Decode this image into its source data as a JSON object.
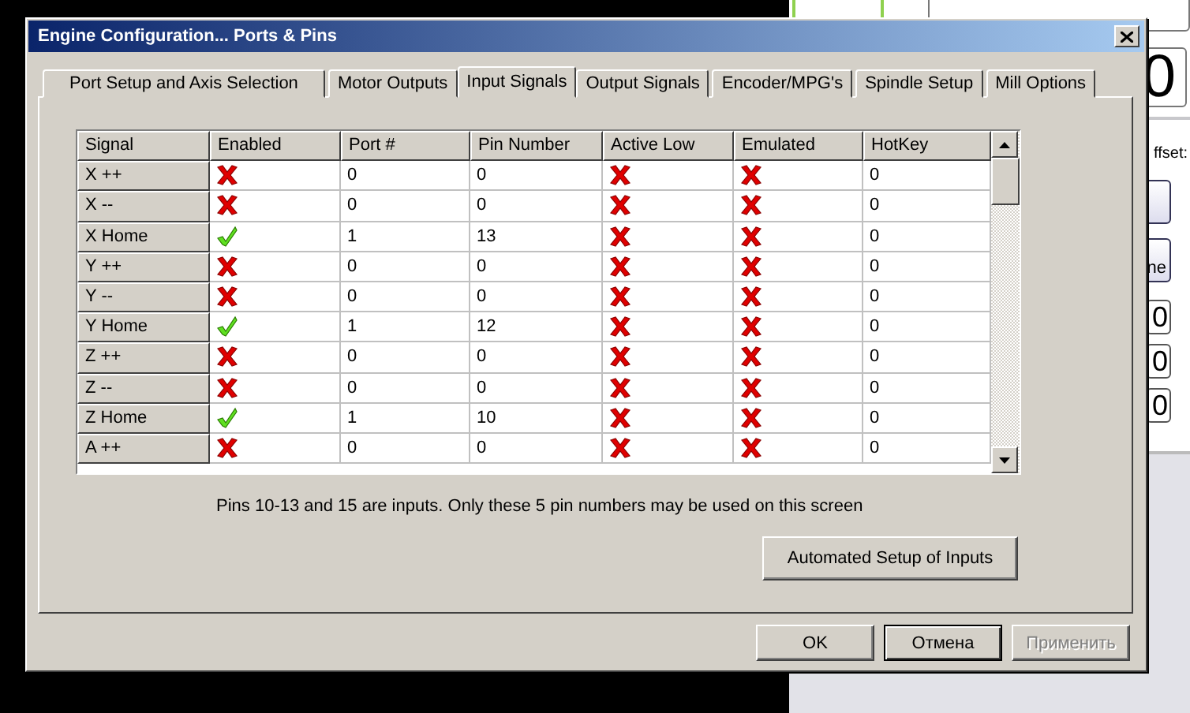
{
  "background_app": {
    "second_readout": "0",
    "offset_label": "ffset:",
    "button_label": "ne",
    "fields": [
      "0",
      "0",
      "0"
    ]
  },
  "window": {
    "title": "Engine Configuration... Ports & Pins"
  },
  "tabs": [
    {
      "label": "Port Setup and Axis Selection",
      "selected": false
    },
    {
      "label": "Motor Outputs",
      "selected": false
    },
    {
      "label": "Input Signals",
      "selected": true
    },
    {
      "label": "Output Signals",
      "selected": false
    },
    {
      "label": "Encoder/MPG's",
      "selected": false
    },
    {
      "label": "Spindle Setup",
      "selected": false
    },
    {
      "label": "Mill Options",
      "selected": false
    }
  ],
  "table": {
    "columns": [
      "Signal",
      "Enabled",
      "Port #",
      "Pin Number",
      "Active Low",
      "Emulated",
      "HotKey"
    ],
    "rows": [
      {
        "signal": "X ++",
        "enabled": false,
        "port": "0",
        "pin": "0",
        "active_low": false,
        "emulated": false,
        "hotkey": "0"
      },
      {
        "signal": "X --",
        "enabled": false,
        "port": "0",
        "pin": "0",
        "active_low": false,
        "emulated": false,
        "hotkey": "0"
      },
      {
        "signal": "X Home",
        "enabled": true,
        "port": "1",
        "pin": "13",
        "active_low": false,
        "emulated": false,
        "hotkey": "0"
      },
      {
        "signal": "Y ++",
        "enabled": false,
        "port": "0",
        "pin": "0",
        "active_low": false,
        "emulated": false,
        "hotkey": "0"
      },
      {
        "signal": "Y --",
        "enabled": false,
        "port": "0",
        "pin": "0",
        "active_low": false,
        "emulated": false,
        "hotkey": "0"
      },
      {
        "signal": "Y Home",
        "enabled": true,
        "port": "1",
        "pin": "12",
        "active_low": false,
        "emulated": false,
        "hotkey": "0"
      },
      {
        "signal": "Z ++",
        "enabled": false,
        "port": "0",
        "pin": "0",
        "active_low": false,
        "emulated": false,
        "hotkey": "0"
      },
      {
        "signal": "Z --",
        "enabled": false,
        "port": "0",
        "pin": "0",
        "active_low": false,
        "emulated": false,
        "hotkey": "0"
      },
      {
        "signal": "Z Home",
        "enabled": true,
        "port": "1",
        "pin": "10",
        "active_low": false,
        "emulated": false,
        "hotkey": "0"
      },
      {
        "signal": "A ++",
        "enabled": false,
        "port": "0",
        "pin": "0",
        "active_low": false,
        "emulated": false,
        "hotkey": "0"
      }
    ]
  },
  "note": "Pins 10-13 and 15 are inputs. Only these 5 pin numbers may be used on this screen",
  "setup_button": "Automated Setup of Inputs",
  "buttons": [
    {
      "label": "OK",
      "kind": "normal"
    },
    {
      "label": "Отмена",
      "kind": "default"
    },
    {
      "label": "Применить",
      "kind": "disabled"
    }
  ]
}
